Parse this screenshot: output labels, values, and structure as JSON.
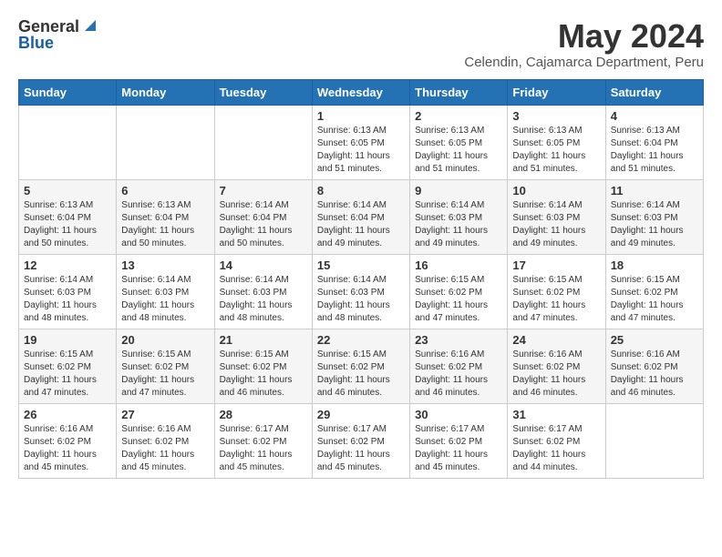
{
  "header": {
    "logo_general": "General",
    "logo_blue": "Blue",
    "title": "May 2024",
    "subtitle": "Celendin, Cajamarca Department, Peru"
  },
  "weekdays": [
    "Sunday",
    "Monday",
    "Tuesday",
    "Wednesday",
    "Thursday",
    "Friday",
    "Saturday"
  ],
  "weeks": [
    [
      {
        "day": "",
        "info": ""
      },
      {
        "day": "",
        "info": ""
      },
      {
        "day": "",
        "info": ""
      },
      {
        "day": "1",
        "info": "Sunrise: 6:13 AM\nSunset: 6:05 PM\nDaylight: 11 hours\nand 51 minutes."
      },
      {
        "day": "2",
        "info": "Sunrise: 6:13 AM\nSunset: 6:05 PM\nDaylight: 11 hours\nand 51 minutes."
      },
      {
        "day": "3",
        "info": "Sunrise: 6:13 AM\nSunset: 6:05 PM\nDaylight: 11 hours\nand 51 minutes."
      },
      {
        "day": "4",
        "info": "Sunrise: 6:13 AM\nSunset: 6:04 PM\nDaylight: 11 hours\nand 51 minutes."
      }
    ],
    [
      {
        "day": "5",
        "info": "Sunrise: 6:13 AM\nSunset: 6:04 PM\nDaylight: 11 hours\nand 50 minutes."
      },
      {
        "day": "6",
        "info": "Sunrise: 6:13 AM\nSunset: 6:04 PM\nDaylight: 11 hours\nand 50 minutes."
      },
      {
        "day": "7",
        "info": "Sunrise: 6:14 AM\nSunset: 6:04 PM\nDaylight: 11 hours\nand 50 minutes."
      },
      {
        "day": "8",
        "info": "Sunrise: 6:14 AM\nSunset: 6:04 PM\nDaylight: 11 hours\nand 49 minutes."
      },
      {
        "day": "9",
        "info": "Sunrise: 6:14 AM\nSunset: 6:03 PM\nDaylight: 11 hours\nand 49 minutes."
      },
      {
        "day": "10",
        "info": "Sunrise: 6:14 AM\nSunset: 6:03 PM\nDaylight: 11 hours\nand 49 minutes."
      },
      {
        "day": "11",
        "info": "Sunrise: 6:14 AM\nSunset: 6:03 PM\nDaylight: 11 hours\nand 49 minutes."
      }
    ],
    [
      {
        "day": "12",
        "info": "Sunrise: 6:14 AM\nSunset: 6:03 PM\nDaylight: 11 hours\nand 48 minutes."
      },
      {
        "day": "13",
        "info": "Sunrise: 6:14 AM\nSunset: 6:03 PM\nDaylight: 11 hours\nand 48 minutes."
      },
      {
        "day": "14",
        "info": "Sunrise: 6:14 AM\nSunset: 6:03 PM\nDaylight: 11 hours\nand 48 minutes."
      },
      {
        "day": "15",
        "info": "Sunrise: 6:14 AM\nSunset: 6:03 PM\nDaylight: 11 hours\nand 48 minutes."
      },
      {
        "day": "16",
        "info": "Sunrise: 6:15 AM\nSunset: 6:02 PM\nDaylight: 11 hours\nand 47 minutes."
      },
      {
        "day": "17",
        "info": "Sunrise: 6:15 AM\nSunset: 6:02 PM\nDaylight: 11 hours\nand 47 minutes."
      },
      {
        "day": "18",
        "info": "Sunrise: 6:15 AM\nSunset: 6:02 PM\nDaylight: 11 hours\nand 47 minutes."
      }
    ],
    [
      {
        "day": "19",
        "info": "Sunrise: 6:15 AM\nSunset: 6:02 PM\nDaylight: 11 hours\nand 47 minutes."
      },
      {
        "day": "20",
        "info": "Sunrise: 6:15 AM\nSunset: 6:02 PM\nDaylight: 11 hours\nand 47 minutes."
      },
      {
        "day": "21",
        "info": "Sunrise: 6:15 AM\nSunset: 6:02 PM\nDaylight: 11 hours\nand 46 minutes."
      },
      {
        "day": "22",
        "info": "Sunrise: 6:15 AM\nSunset: 6:02 PM\nDaylight: 11 hours\nand 46 minutes."
      },
      {
        "day": "23",
        "info": "Sunrise: 6:16 AM\nSunset: 6:02 PM\nDaylight: 11 hours\nand 46 minutes."
      },
      {
        "day": "24",
        "info": "Sunrise: 6:16 AM\nSunset: 6:02 PM\nDaylight: 11 hours\nand 46 minutes."
      },
      {
        "day": "25",
        "info": "Sunrise: 6:16 AM\nSunset: 6:02 PM\nDaylight: 11 hours\nand 46 minutes."
      }
    ],
    [
      {
        "day": "26",
        "info": "Sunrise: 6:16 AM\nSunset: 6:02 PM\nDaylight: 11 hours\nand 45 minutes."
      },
      {
        "day": "27",
        "info": "Sunrise: 6:16 AM\nSunset: 6:02 PM\nDaylight: 11 hours\nand 45 minutes."
      },
      {
        "day": "28",
        "info": "Sunrise: 6:17 AM\nSunset: 6:02 PM\nDaylight: 11 hours\nand 45 minutes."
      },
      {
        "day": "29",
        "info": "Sunrise: 6:17 AM\nSunset: 6:02 PM\nDaylight: 11 hours\nand 45 minutes."
      },
      {
        "day": "30",
        "info": "Sunrise: 6:17 AM\nSunset: 6:02 PM\nDaylight: 11 hours\nand 45 minutes."
      },
      {
        "day": "31",
        "info": "Sunrise: 6:17 AM\nSunset: 6:02 PM\nDaylight: 11 hours\nand 44 minutes."
      },
      {
        "day": "",
        "info": ""
      }
    ]
  ]
}
